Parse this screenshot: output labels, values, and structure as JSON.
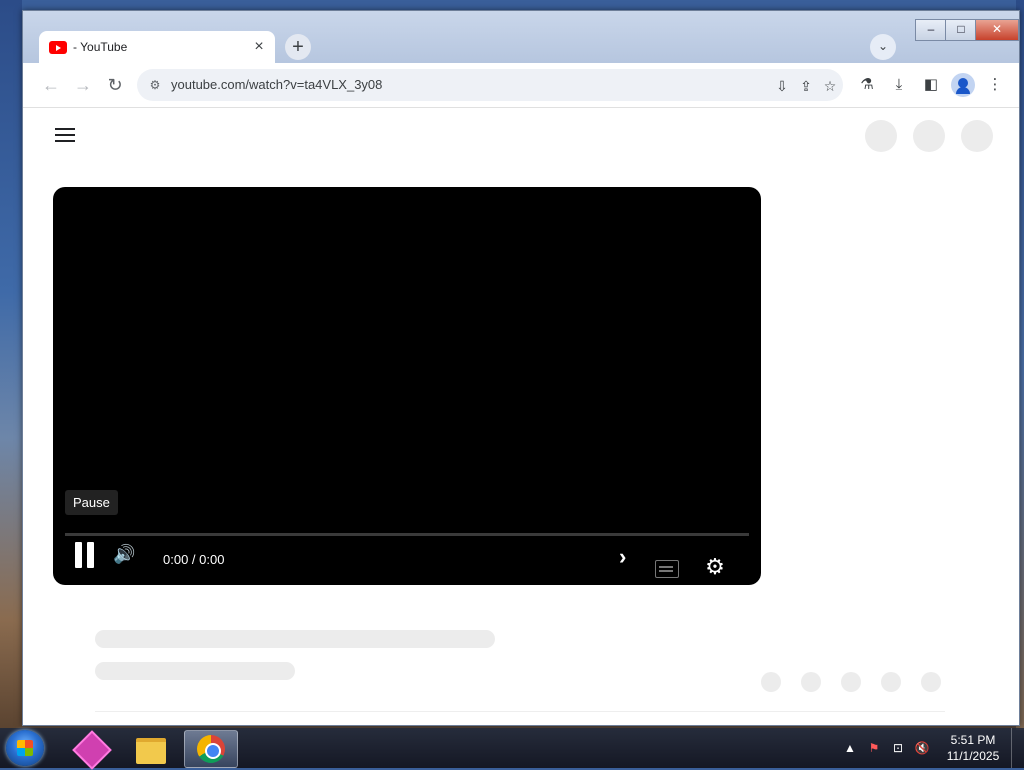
{
  "browser": {
    "tab": {
      "title": "- YouTube",
      "close": "×"
    },
    "new_tab": "+",
    "tab_search": "⌄",
    "window_controls": {
      "minimize": "–",
      "maximize": "□",
      "close": "✕"
    },
    "nav": {
      "back": "←",
      "forward": "→",
      "reload": "↻"
    },
    "address": {
      "url": "youtube.com/watch?v=ta4VLX_3y08",
      "site_info": "⚙"
    },
    "omnibox_icons": {
      "install": "⇩",
      "share": "⇪",
      "bookmark": "☆"
    },
    "toolbar_icons": {
      "labs": "⚗",
      "downloads": "⤓",
      "side_panel": "◧",
      "menu": "⋮"
    }
  },
  "page": {
    "hamburger": "menu",
    "player": {
      "tooltip": "Pause",
      "time": "0:00 / 0:00",
      "volume": "🔊",
      "next": "›",
      "settings": "⚙"
    }
  },
  "taskbar": {
    "tray": {
      "up_arrow": "▲",
      "flag": "⚑",
      "network": "⊡",
      "volume_muted": "🔇"
    },
    "clock": {
      "time": "5:51 PM",
      "date": "11/1/2025"
    }
  }
}
